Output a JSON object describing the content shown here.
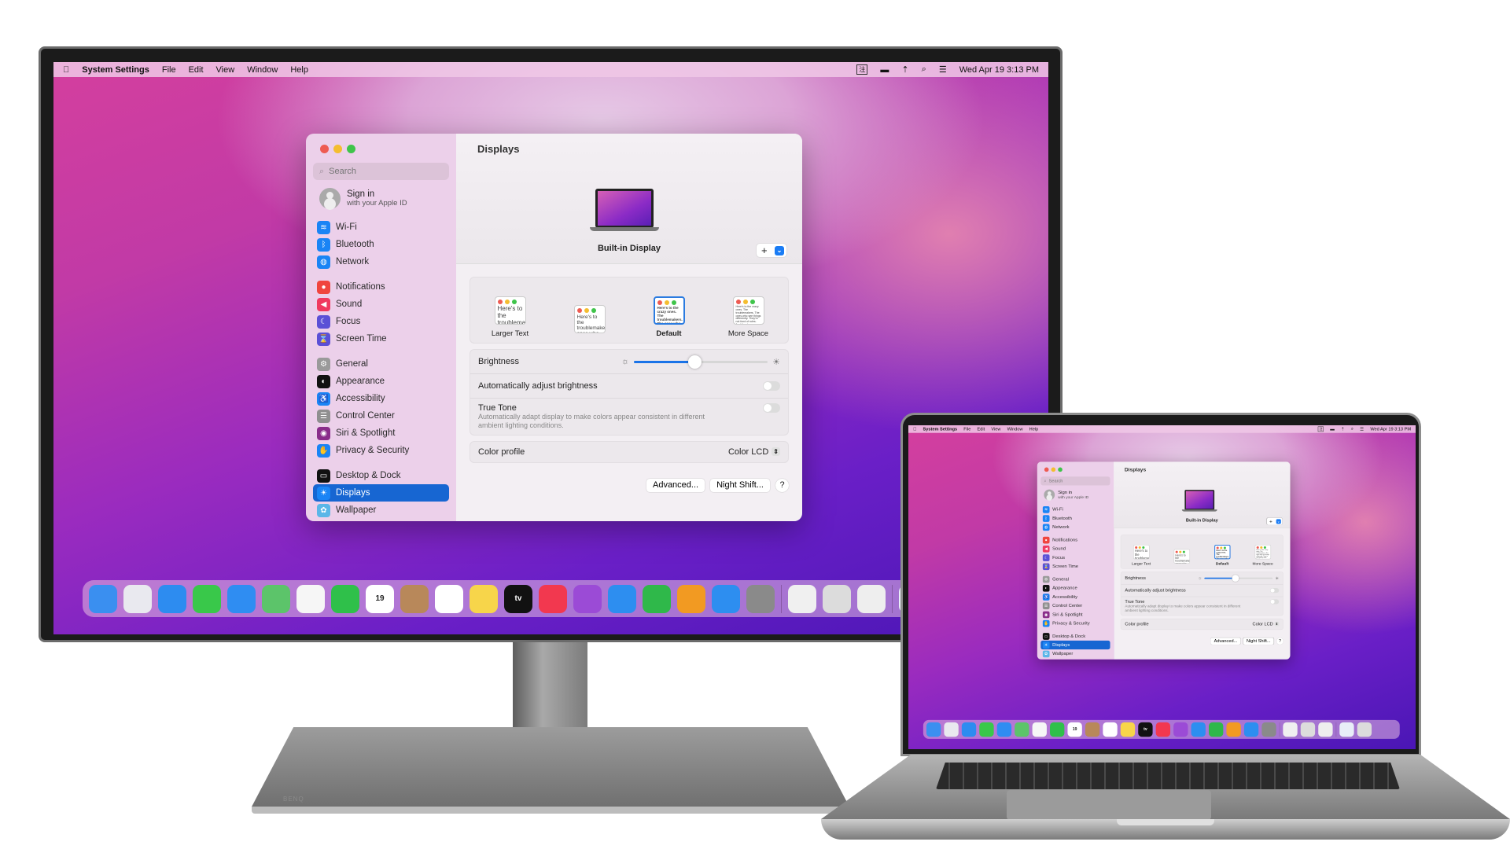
{
  "menubar": {
    "app": "System Settings",
    "menus": [
      "File",
      "Edit",
      "View",
      "Window",
      "Help"
    ],
    "clock": "Wed Apr 19  3:13 PM",
    "status_icons": [
      "input-method-icon",
      "battery-icon",
      "wifi-icon",
      "search-icon",
      "control-center-icon"
    ]
  },
  "window": {
    "search_placeholder": "Search",
    "account": {
      "title": "Sign in",
      "subtitle": "with your Apple ID"
    },
    "sidebar": [
      [
        {
          "label": "Wi-Fi",
          "icon": "wifi-icon",
          "color": "#1a84f5",
          "glyph": "≋"
        },
        {
          "label": "Bluetooth",
          "icon": "bluetooth-icon",
          "color": "#1a84f5",
          "glyph": "ᛒ"
        },
        {
          "label": "Network",
          "icon": "globe-icon",
          "color": "#1a84f5",
          "glyph": "◍"
        }
      ],
      [
        {
          "label": "Notifications",
          "icon": "bell-icon",
          "color": "#f0453e",
          "glyph": "●"
        },
        {
          "label": "Sound",
          "icon": "speaker-icon",
          "color": "#f03a5f",
          "glyph": "◀"
        },
        {
          "label": "Focus",
          "icon": "moon-icon",
          "color": "#5b50d6",
          "glyph": "☾"
        },
        {
          "label": "Screen Time",
          "icon": "hourglass-icon",
          "color": "#5b50d6",
          "glyph": "⌛"
        }
      ],
      [
        {
          "label": "General",
          "icon": "gear-icon",
          "color": "#9a9a9a",
          "glyph": "⚙"
        },
        {
          "label": "Appearance",
          "icon": "appearance-icon",
          "color": "#111111",
          "glyph": "◐"
        },
        {
          "label": "Accessibility",
          "icon": "accessibility-icon",
          "color": "#1a84f5",
          "glyph": "♿"
        },
        {
          "label": "Control Center",
          "icon": "toggles-icon",
          "color": "#8f8f8f",
          "glyph": "☰"
        },
        {
          "label": "Siri & Spotlight",
          "icon": "siri-icon",
          "color": "#8a2d8a",
          "glyph": "◉"
        },
        {
          "label": "Privacy & Security",
          "icon": "hand-icon",
          "color": "#1a84f5",
          "glyph": "✋"
        }
      ],
      [
        {
          "label": "Desktop & Dock",
          "icon": "dock-icon",
          "color": "#111111",
          "glyph": "▭"
        },
        {
          "label": "Displays",
          "icon": "sun-icon",
          "color": "#1a84f5",
          "glyph": "☀",
          "selected": true
        },
        {
          "label": "Wallpaper",
          "icon": "flower-icon",
          "color": "#5ab6e8",
          "glyph": "✿"
        }
      ]
    ],
    "title": "Displays",
    "display_name": "Built-in Display",
    "add_button": "+",
    "resolutions": [
      {
        "label": "Larger Text",
        "preview": "Here's to the troublemakers"
      },
      {
        "label": "",
        "preview": "Here's to the troublemakers ones who"
      },
      {
        "label": "Default",
        "preview": "Here's to the crazy ones. The troublemakers. The ones who see things differently. rules. And they",
        "selected": true
      },
      {
        "label": "More Space",
        "preview": "Here's to the crazy ones. The troublemakers. The ones who see things differently. They're not fond of rules. And they have no respect for the status quo. You can quote them, disagree with them."
      }
    ],
    "brightness": {
      "label": "Brightness",
      "value": 0.45
    },
    "auto_brightness": {
      "label": "Automatically adjust brightness",
      "on": false
    },
    "true_tone": {
      "label": "True Tone",
      "description": "Automatically adapt display to make colors appear consistent in different ambient lighting conditions.",
      "on": false
    },
    "color_profile": {
      "label": "Color profile",
      "value": "Color LCD"
    },
    "buttons": {
      "advanced": "Advanced...",
      "night_shift": "Night Shift...",
      "help": "?"
    }
  },
  "dock": [
    {
      "name": "finder",
      "color": "#3a8ff0"
    },
    {
      "name": "launchpad",
      "color": "#e9e9ef"
    },
    {
      "name": "safari",
      "color": "#2d8cf0"
    },
    {
      "name": "messages",
      "color": "#39c84a"
    },
    {
      "name": "mail",
      "color": "#2f8df2"
    },
    {
      "name": "maps",
      "color": "#5cc46a"
    },
    {
      "name": "photos",
      "color": "#f6f6f6"
    },
    {
      "name": "facetime",
      "color": "#2fc04a"
    },
    {
      "name": "calendar",
      "color": "#ffffff",
      "text": "19"
    },
    {
      "name": "contacts",
      "color": "#b8885a"
    },
    {
      "name": "reminders",
      "color": "#ffffff"
    },
    {
      "name": "notes",
      "color": "#f7d54a"
    },
    {
      "name": "tv",
      "color": "#111111",
      "text": "tv"
    },
    {
      "name": "music",
      "color": "#f2384f"
    },
    {
      "name": "podcasts",
      "color": "#9b4bd6"
    },
    {
      "name": "keynote",
      "color": "#2d8ef0"
    },
    {
      "name": "numbers",
      "color": "#2fb84a"
    },
    {
      "name": "pages",
      "color": "#f29a22"
    },
    {
      "name": "app-store",
      "color": "#2d8ef0"
    },
    {
      "name": "system-settings",
      "color": "#8a8a8a"
    },
    {
      "sep": true
    },
    {
      "name": "color-picker",
      "color": "#f0f0f0"
    },
    {
      "name": "preview",
      "color": "#dcdcdc"
    },
    {
      "name": "printer",
      "color": "#eeeeee"
    },
    {
      "sep": true
    },
    {
      "name": "downloads",
      "color": "#e8eef8"
    },
    {
      "name": "trash",
      "color": "#dcdcdc"
    }
  ],
  "monitor": {
    "brand": "BENQ"
  }
}
